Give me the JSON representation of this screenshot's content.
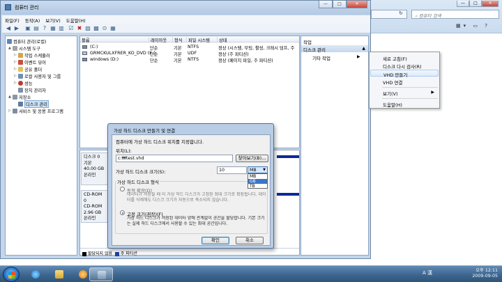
{
  "window": {
    "title": "컴퓨터 관리",
    "controls": {
      "minimize": "—",
      "maximize": "□",
      "close": "✕"
    }
  },
  "menubar": [
    "파일(F)",
    "동작(A)",
    "보기(V)",
    "도움말(H)"
  ],
  "tree": [
    {
      "label": "컴퓨터 관리(로컬)",
      "icon": "computer-management-icon",
      "exp": "",
      "level": 0
    },
    {
      "label": "시스템 도구",
      "icon": "tools-icon",
      "exp": "▲",
      "level": 1
    },
    {
      "label": "작업 스케줄러",
      "icon": "clock-icon",
      "exp": "▷",
      "level": 2
    },
    {
      "label": "이벤트 뷰어",
      "icon": "event-icon",
      "exp": "▷",
      "level": 2
    },
    {
      "label": "공유 폴더",
      "icon": "folder-icon",
      "exp": "▷",
      "level": 2
    },
    {
      "label": "로컬 사용자 및 그룹",
      "icon": "users-icon",
      "exp": "▷",
      "level": 2
    },
    {
      "label": "성능",
      "icon": "performance-icon",
      "exp": "▷",
      "level": 2
    },
    {
      "label": "장치 관리자",
      "icon": "device-manager-icon",
      "exp": "",
      "level": 2
    },
    {
      "label": "저장소",
      "icon": "storage-icon",
      "exp": "▲",
      "level": 1
    },
    {
      "label": "디스크 관리",
      "icon": "disk-management-icon",
      "exp": "",
      "level": 2,
      "selected": true
    },
    {
      "label": "서비스 및 응용 프로그램",
      "icon": "services-icon",
      "exp": "▷",
      "level": 1
    }
  ],
  "volumes": {
    "headers": [
      "볼륨",
      "레이아웃",
      "형식",
      "파일 시스템",
      "상태"
    ],
    "rows": [
      [
        "(C:)",
        "단순",
        "기본",
        "NTFS",
        "정상 (시스템, 부팅, 활성, 크래시 덤프, 주"
      ],
      [
        "GRMCKULXFRER_KO_DVD (E:)",
        "단순",
        "기본",
        "UDF",
        "정상 (주 파티션)"
      ],
      [
        "windows (D:)",
        "단순",
        "기본",
        "NTFS",
        "정상 (페이지 파일, 주 파티션)"
      ]
    ]
  },
  "disks": [
    {
      "name": "디스크 0",
      "type": "기본",
      "size": "40.00 GB",
      "status": "온라인"
    },
    {
      "name": "CD-ROM 0",
      "type": "CD-ROM",
      "size": "2.96 GB",
      "status": "온라인"
    }
  ],
  "legend": [
    "할당되지 않음",
    "주 파티션"
  ],
  "actions": {
    "header": "작업",
    "section": "디스크 관리",
    "more": "기타 작업"
  },
  "context_menu": {
    "items": [
      "새로 고침(F)",
      "디스크 다시 검사(R)",
      "VHD 만들기",
      "VHD 연결",
      "보기(V)",
      "도움말(H)"
    ],
    "hovered": "VHD 만들기"
  },
  "dialog": {
    "title": "가상 하드 디스크 만들기 및 연결",
    "prompt": "컴퓨터에 가상 하드 디스크 위치를 지정합니다.",
    "location_label": "위치(L):",
    "location_value": "c:₩test.vhd",
    "browse_button": "찾아보기(B)...",
    "size_label": "가상 하드 디스크 크기(S):",
    "size_value": "10",
    "unit_selected": "MB",
    "unit_options": [
      "MB",
      "GB",
      "TB"
    ],
    "format_label": "가상 하드 디스크 형식",
    "dynamic_label": "동적 확장(D)",
    "dynamic_desc": "데이터가 저장될 때 이 가상 하드 디스크가 고정된 최대 크기로 확장됩니다. 데이터를 삭제해도 디스크 크기가 자동으로 축소되지 않습니다.",
    "fixed_label": "고정 크기(권장)(F)",
    "fixed_desc": "가상 하드 디스크가 저장된 데이터 양에 관계없이 공간을 할당합니다. 기본 크기는 실제 하드 디스크에서 사용할 수 있는 최대 공간입니다.",
    "ok_button": "확인",
    "cancel_button": "취소"
  },
  "background_window": {
    "search_placeholder": "컴퓨터 검색"
  },
  "tray": {
    "ime": "A 漢",
    "time": "오후 12:11",
    "date": "2009-09-05"
  }
}
